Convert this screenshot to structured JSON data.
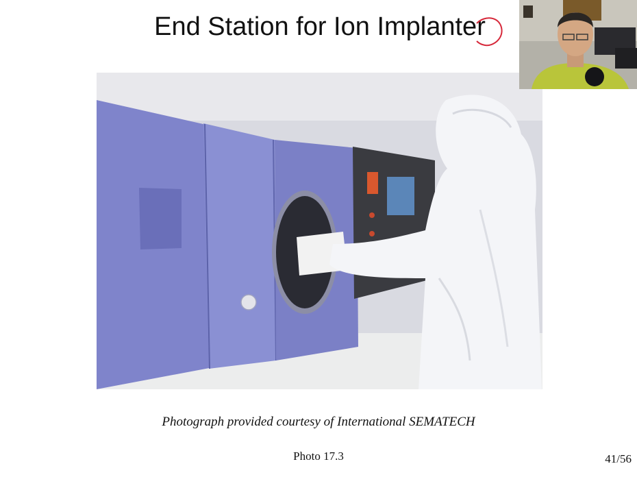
{
  "slide": {
    "title": "End Station for Ion Implanter",
    "caption": "Photograph provided courtesy of International SEMATECH",
    "photo_label": "Photo 17.3",
    "page_indicator": "41/56"
  },
  "colors": {
    "annotation_ink": "#d6283a",
    "machine_panel": "#7d82c9",
    "background": "#ffffff"
  },
  "icons": {
    "annotation": "red-pen-circle-annotation"
  }
}
